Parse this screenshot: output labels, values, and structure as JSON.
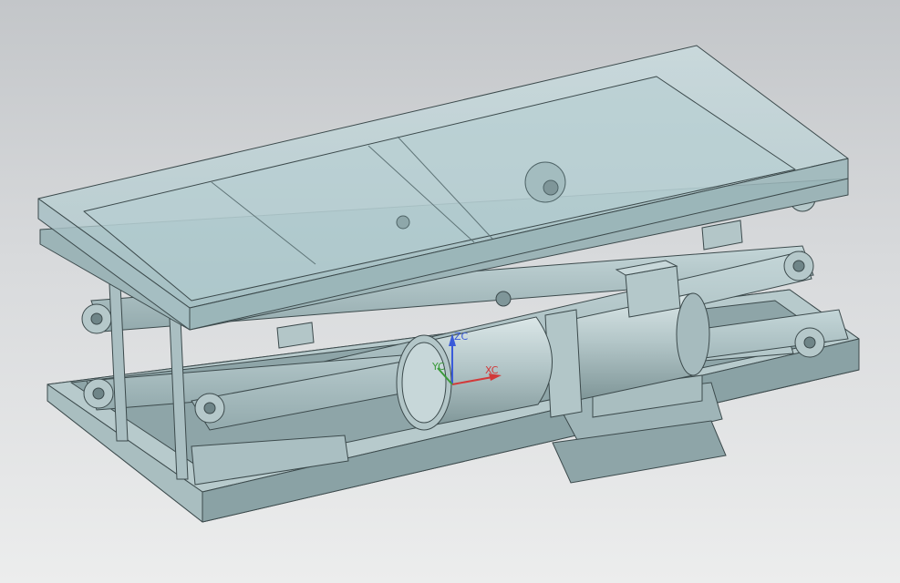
{
  "viewport": {
    "background_top": "#c3c6c9",
    "background_bottom": "#eceded"
  },
  "model": {
    "part_color": "#a9c0c3",
    "part_shadow": "#7f9699",
    "glass_color": "#b9d3d8",
    "edge_color": "#3c4a4c"
  },
  "triad": {
    "zc_label": "ZC",
    "yc_label": "YC",
    "xc_label": "XC",
    "zc_color": "#3a5bd9",
    "yc_color": "#3a9a3a",
    "xc_color": "#d23a3a"
  }
}
